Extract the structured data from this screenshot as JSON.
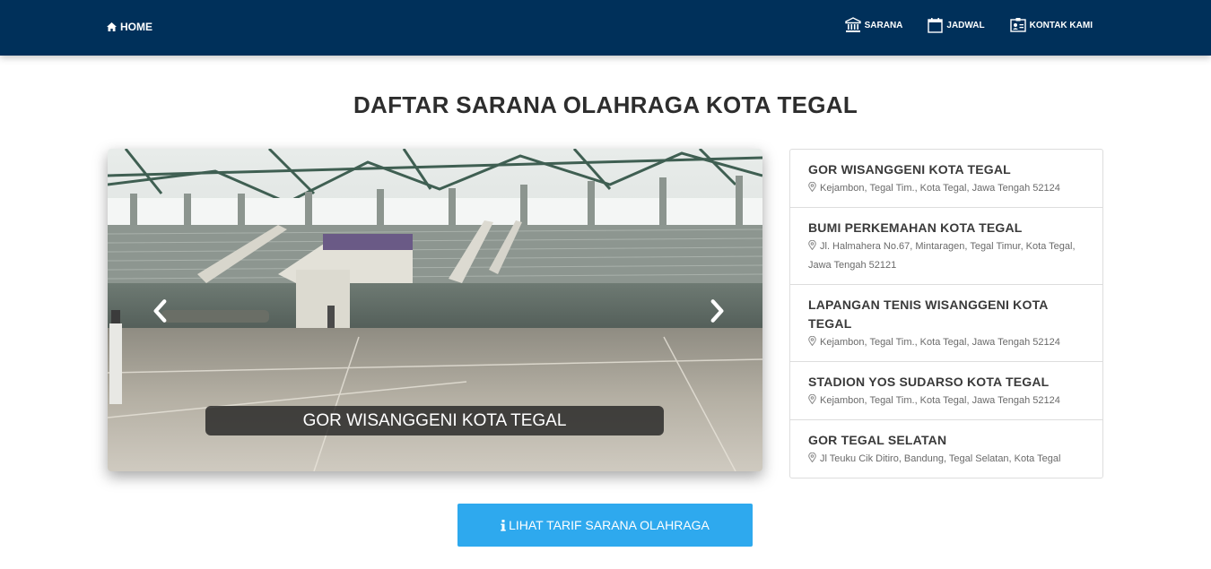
{
  "nav": {
    "home_label": "HOME",
    "items": [
      {
        "label": "SARANA",
        "icon": "bank-icon"
      },
      {
        "label": "JADWAL",
        "icon": "calendar-icon"
      },
      {
        "label": "KONTAK KAMI",
        "icon": "contact-card-icon"
      }
    ]
  },
  "page": {
    "title": "DAFTAR SARANA OLAHRAGA KOTA TEGAL"
  },
  "carousel": {
    "caption": "GOR WISANGGENI KOTA TEGAL"
  },
  "venues": [
    {
      "name": "GOR WISANGGENI KOTA TEGAL",
      "address": "Kejambon, Tegal Tim., Kota Tegal, Jawa Tengah 52124"
    },
    {
      "name": "BUMI PERKEMAHAN KOTA TEGAL",
      "address": "Jl. Halmahera No.67, Mintaragen, Tegal Timur, Kota Tegal, Jawa Tengah 52121"
    },
    {
      "name": "LAPANGAN TENIS WISANGGENI KOTA TEGAL",
      "address": "Kejambon, Tegal Tim., Kota Tegal, Jawa Tengah 52124"
    },
    {
      "name": "STADION YOS SUDARSO KOTA TEGAL",
      "address": "Kejambon, Tegal Tim., Kota Tegal, Jawa Tengah 52124"
    },
    {
      "name": "GOR TEGAL SELATAN",
      "address": "Jl Teuku Cik Ditiro, Bandung, Tegal Selatan, Kota Tegal"
    }
  ],
  "button": {
    "tarif_label": "LIHAT TARIF SARANA OLAHRAGA"
  },
  "colors": {
    "navbar": "#00305a",
    "button": "#2ea9ee"
  }
}
